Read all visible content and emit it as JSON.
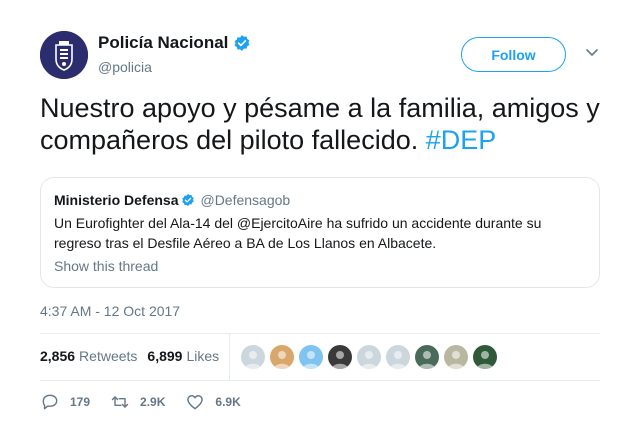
{
  "author": {
    "name": "Policía Nacional",
    "handle": "@policia",
    "verified": true,
    "avatar_icon": "police-shield-icon"
  },
  "follow_button": {
    "label": "Follow"
  },
  "tweet": {
    "text": "Nuestro apoyo y pésame a la familia, amigos y compañeros del piloto fallecido.",
    "hashtag": "#DEP"
  },
  "quoted_tweet": {
    "name": "Ministerio Defensa",
    "handle": "@Defensagob",
    "verified": true,
    "text": "Un Eurofighter del Ala-14 del @EjercitoAire ha sufrido un accidente durante su regreso tras el Desfile Aéreo a BA de Los Llanos en Albacete.",
    "show_thread": "Show this thread"
  },
  "timestamp": "4:37 AM - 12 Oct 2017",
  "stats": {
    "retweets_count": "2,856",
    "retweets_label": "Retweets",
    "likes_count": "6,899",
    "likes_label": "Likes"
  },
  "likers": [
    {
      "color": "#ccd6dd"
    },
    {
      "color": "#d9a66b"
    },
    {
      "color": "#7fc3f0"
    },
    {
      "color": "#3a3a3a"
    },
    {
      "color": "#ccd6dd"
    },
    {
      "color": "#ccd6dd"
    },
    {
      "color": "#4a6b5a"
    },
    {
      "color": "#b8b8a0"
    },
    {
      "color": "#2e5a3a"
    }
  ],
  "actions": {
    "replies": "179",
    "retweets": "2.9K",
    "likes": "6.9K"
  },
  "colors": {
    "accent": "#1da1f2",
    "secondary_text": "#657786",
    "verified_badge": "#1da1f2"
  }
}
